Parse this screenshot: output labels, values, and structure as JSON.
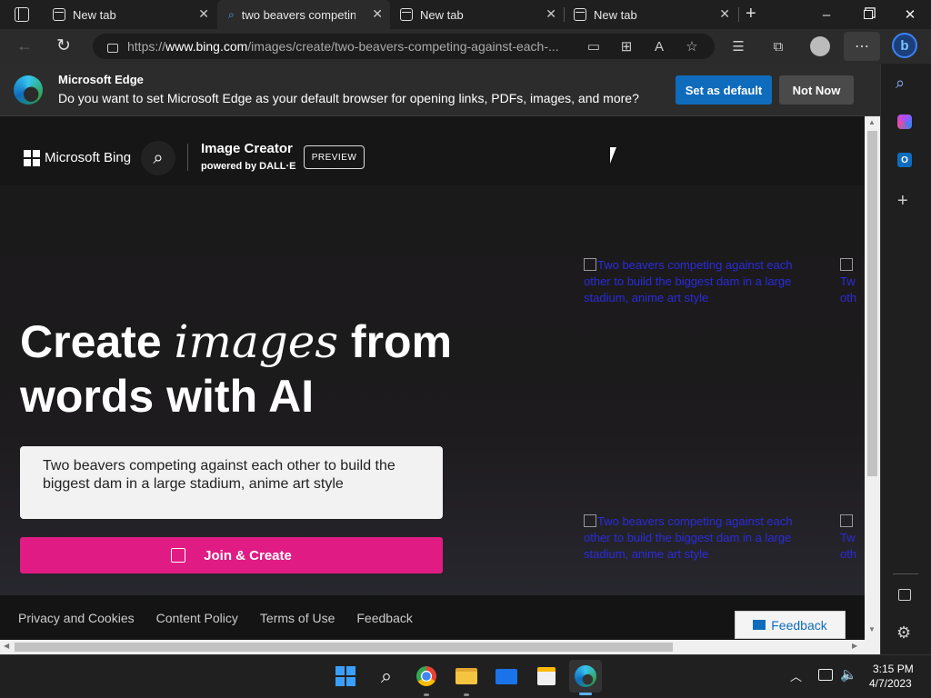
{
  "tabs": [
    {
      "label": "New tab",
      "active": false
    },
    {
      "label": "two beavers competing",
      "active": true
    },
    {
      "label": "New tab",
      "active": false
    },
    {
      "label": "New tab",
      "active": false
    }
  ],
  "address": {
    "prefix": "https://",
    "domain": "www.bing.com",
    "path": "/images/create/two-beavers-competing-against-each-..."
  },
  "infobar": {
    "title": "Microsoft Edge",
    "message": "Do you want to set Microsoft Edge as your default browser for opening links, PDFs, images, and more?",
    "set_default": "Set as default",
    "not_now": "Not Now"
  },
  "bing": {
    "brand": "Microsoft Bing",
    "product": "Image Creator",
    "powered": "powered by DALL·E",
    "preview": "PREVIEW",
    "hero_1": "Create",
    "hero_em": "images",
    "hero_2": "from",
    "hero_line2": "words with AI",
    "prompt": "Two beavers competing against each other to build the biggest dam in a large stadium, anime art style",
    "join": "Join & Create",
    "broken_alt": "Two beavers competing against each other to build the biggest dam in a large stadium, anime art style",
    "broken_alt_short": "Tw oth sta"
  },
  "footer": {
    "links": [
      "Privacy and Cookies",
      "Content Policy",
      "Terms of Use",
      "Feedback"
    ],
    "feedback_btn": "Feedback"
  },
  "taskbar": {
    "time": "3:15 PM",
    "date": "4/7/2023"
  },
  "colors": {
    "accent": "#0f6cbd",
    "join": "#e01c84",
    "link": "#2b2bdc"
  }
}
